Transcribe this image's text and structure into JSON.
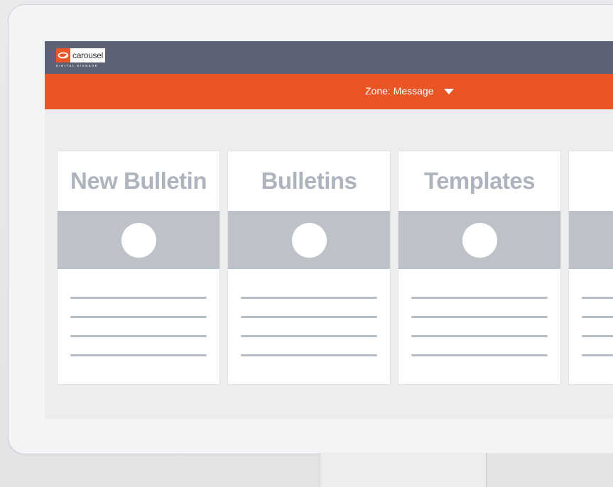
{
  "brand": {
    "name": "carousel",
    "tagline": "DIGITAL SIGNAGE",
    "color": "#ea5525"
  },
  "topbar": {
    "color": "#5c6273"
  },
  "zone": {
    "label": "Zone: Message",
    "icon": "chevron-down-icon"
  },
  "cards": [
    {
      "title": "New Bulletin"
    },
    {
      "title": "Bulletins"
    },
    {
      "title": "Templates"
    },
    {
      "title": ""
    }
  ]
}
